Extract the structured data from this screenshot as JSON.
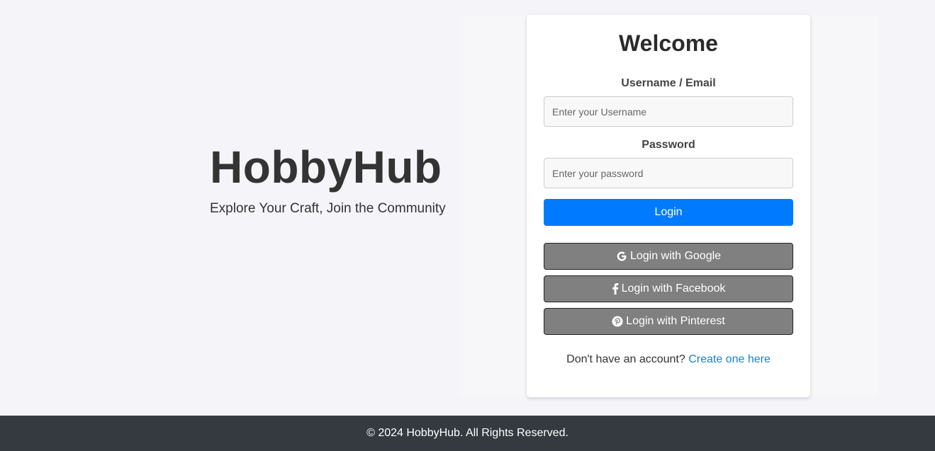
{
  "hero": {
    "brand": "HobbyHub",
    "tagline": "Explore Your Craft, Join the Community"
  },
  "login_card": {
    "title": "Welcome",
    "username": {
      "label": "Username / Email",
      "placeholder": "Enter your Username",
      "value": ""
    },
    "password": {
      "label": "Password",
      "placeholder": "Enter your password",
      "value": ""
    },
    "login_button": "Login",
    "social": [
      {
        "label": "Login with Google",
        "icon": "google-icon"
      },
      {
        "label": "Login with Facebook",
        "icon": "facebook-icon"
      },
      {
        "label": "Login with Pinterest",
        "icon": "pinterest-icon"
      }
    ],
    "signup_prompt": "Don't have an account?",
    "signup_link": "Create one here"
  },
  "footer": {
    "text": "© 2024 HobbyHub. All Rights Reserved."
  },
  "colors": {
    "background": "#f4f4f9",
    "primary": "#007bff",
    "social_button": "#808080",
    "link": "#1a7fd4",
    "footer": "#343a40"
  }
}
